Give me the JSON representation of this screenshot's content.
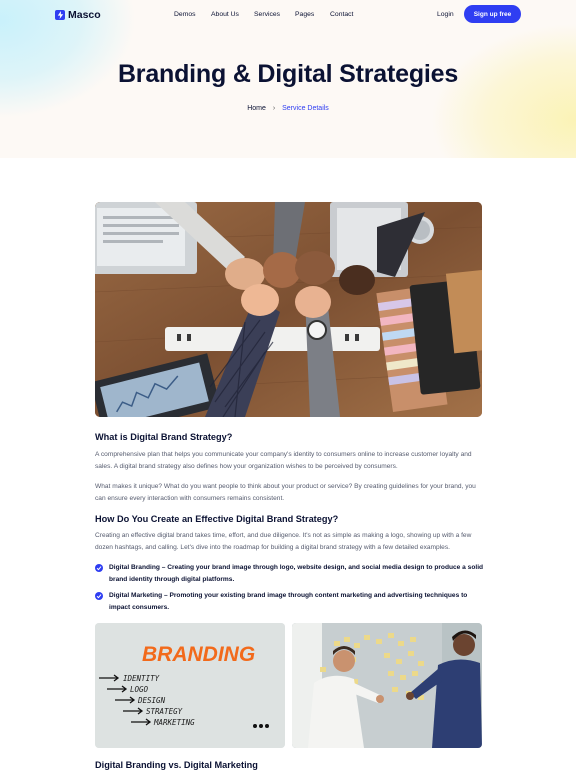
{
  "nav": {
    "logo": "Masco",
    "menu": [
      "Demos",
      "About Us",
      "Services",
      "Pages",
      "Contact"
    ],
    "login": "Login",
    "signup": "Sign up free"
  },
  "hero": {
    "title": "Branding & Digital Strategies",
    "breadcrumb": {
      "home": "Home",
      "separator": "›",
      "current": "Service Details"
    }
  },
  "content": {
    "section1_title": "What is Digital Brand Strategy?",
    "p1": "A comprehensive plan that helps you communicate your company's identity to consumers online to increase customer loyalty and sales. A digital brand strategy also defines how your organization wishes to be perceived by consumers.",
    "p2": "What makes it unique? What do you want people to think about your product or service? By creating guidelines for your brand, you can ensure every interaction with consumers remains consistent.",
    "section2_title": "How Do You Create an Effective Digital Brand Strategy?",
    "p3": "Creating an effective digital brand takes time, effort, and due diligence. It's not as simple as making a logo, showing up with a few dozen hashtags, and calling. Let's dive into the roadmap for building a digital brand strategy with a few detailed examples.",
    "checks": [
      "Digital Branding – Creating your brand image through logo, website design, and social media design to produce a solid brand identity through digital platforms.",
      "Digital Marketing – Promoting your existing brand image through content marketing and advertising techniques to impact consumers."
    ],
    "section3_title": "Digital Branding vs. Digital Marketing",
    "branding_board": {
      "heading": "BRANDING",
      "items": [
        "IDENTITY",
        "LOGO",
        "DESIGN",
        "STRATEGY",
        "MARKETING"
      ]
    }
  },
  "colors": {
    "accent": "#2f3ef2",
    "heading": "#0b1233",
    "body": "#555b6e",
    "branding_orange": "#f26a1b"
  },
  "icons": {
    "logo": "lightning-logo-icon",
    "check": "check-circle-icon"
  }
}
